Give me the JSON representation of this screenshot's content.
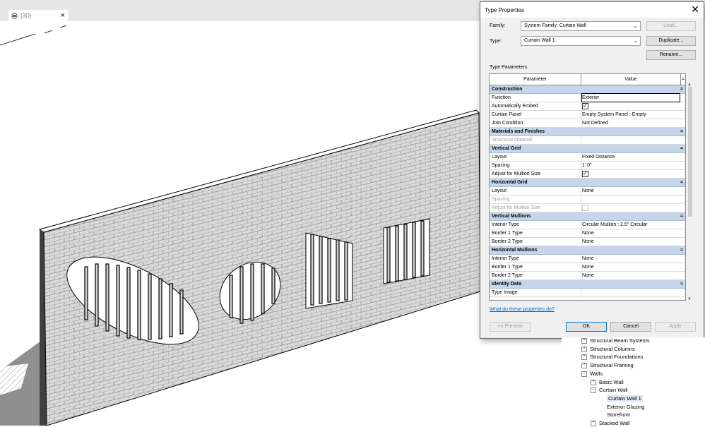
{
  "tab": {
    "label": "{3D}",
    "close": "×"
  },
  "dialog": {
    "title": "Type Properties",
    "close": "✕",
    "family_label": "Family:",
    "family_value": "System Family: Curtain Wall",
    "type_label": "Type:",
    "type_value": "Curtain Wall 1",
    "load_button": "Load...",
    "duplicate_button": "Duplicate...",
    "rename_button": "Rename...",
    "type_parameters_label": "Type Parameters",
    "columns": {
      "parameter": "Parameter",
      "value": "Value",
      "eq": "="
    },
    "help_link": "What do these properties do?",
    "preview_button": "<< Preview",
    "ok_button": "OK",
    "cancel_button": "Cancel",
    "apply_button": "Apply"
  },
  "groups": [
    {
      "name": "Construction",
      "rows": [
        {
          "param": "Function",
          "value": "Exterior",
          "selected": true
        },
        {
          "param": "Automatically Embed",
          "check": "on"
        },
        {
          "param": "Curtain Panel",
          "value": "Empty System Panel : Empty"
        },
        {
          "param": "Join Condition",
          "value": "Not Defined"
        }
      ]
    },
    {
      "name": "Materials and Finishes",
      "rows": [
        {
          "param": "Structural Material",
          "value": "",
          "dim": true
        }
      ]
    },
    {
      "name": "Vertical Grid",
      "rows": [
        {
          "param": "Layout",
          "value": "Fixed Distance"
        },
        {
          "param": "Spacing",
          "value": "1'  0\""
        },
        {
          "param": "Adjust for Mullion Size",
          "check": "on"
        }
      ]
    },
    {
      "name": "Horizontal Grid",
      "rows": [
        {
          "param": "Layout",
          "value": "None"
        },
        {
          "param": "Spacing",
          "value": "",
          "dim": true
        },
        {
          "param": "Adjust for Mullion Size",
          "check": "off",
          "dim": true
        }
      ]
    },
    {
      "name": "Vertical Mullions",
      "rows": [
        {
          "param": "Interior Type",
          "value": "Circular Mullion : 2.5\" Circular"
        },
        {
          "param": "Border 1 Type",
          "value": "None"
        },
        {
          "param": "Border 2 Type",
          "value": "None"
        }
      ]
    },
    {
      "name": "Horizontal Mullions",
      "rows": [
        {
          "param": "Interior Type",
          "value": "None"
        },
        {
          "param": "Border 1 Type",
          "value": "None"
        },
        {
          "param": "Border 2 Type",
          "value": "None"
        }
      ]
    },
    {
      "name": "Identity Data",
      "rows": [
        {
          "param": "Type Image",
          "value": ""
        }
      ]
    }
  ],
  "collapse_glyph": "≈",
  "browser": {
    "items": [
      {
        "label": "Structural Beam Systems",
        "level": 0,
        "pm": "+"
      },
      {
        "label": "Structural Columns",
        "level": 0,
        "pm": "+"
      },
      {
        "label": "Structural Foundations",
        "level": 0,
        "pm": "+"
      },
      {
        "label": "Structural Framing",
        "level": 0,
        "pm": "+"
      },
      {
        "label": "Walls",
        "level": 0,
        "pm": "−"
      },
      {
        "label": "Basic Wall",
        "level": 1,
        "pm": "+"
      },
      {
        "label": "Curtain Wall",
        "level": 1,
        "pm": "−"
      },
      {
        "label": "Curtain Wall 1",
        "level": 2,
        "pm": "",
        "highlight": true
      },
      {
        "label": "Exterior Glazing",
        "level": 2,
        "pm": ""
      },
      {
        "label": "Storefront",
        "level": 2,
        "pm": ""
      },
      {
        "label": "Stacked Wall",
        "level": 1,
        "pm": "+"
      }
    ]
  }
}
